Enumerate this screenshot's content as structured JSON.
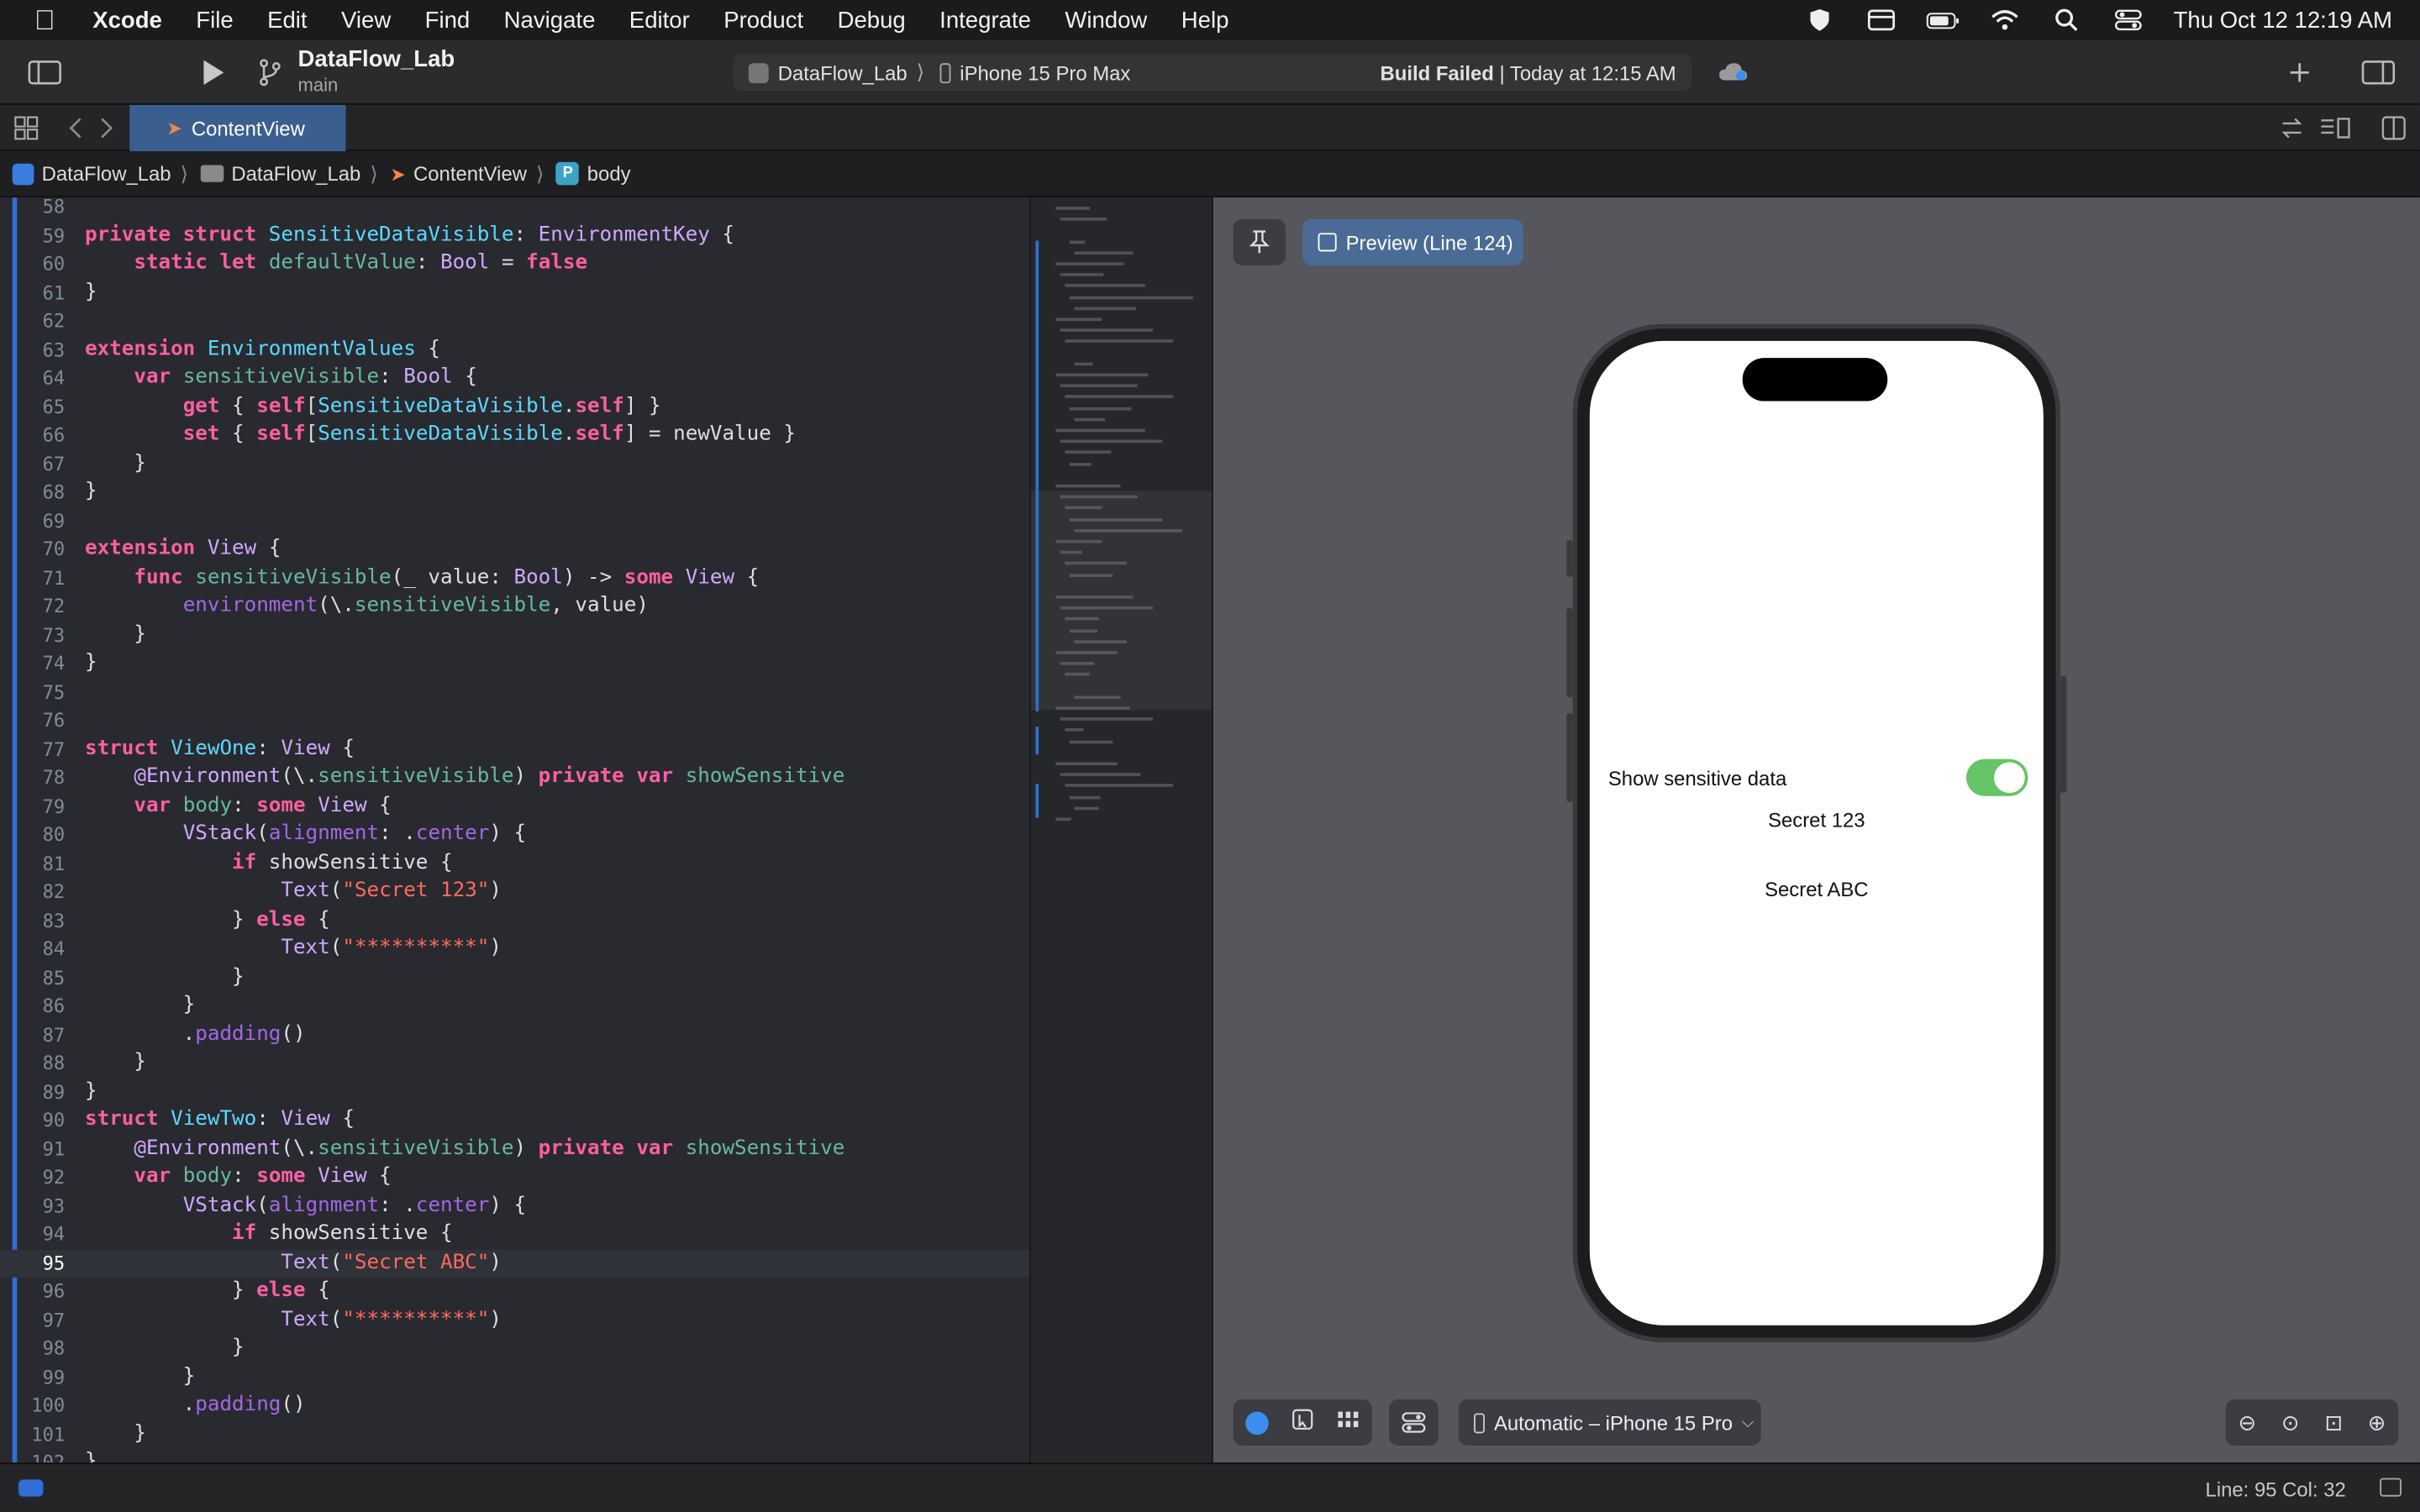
{
  "menubar": {
    "app": "Xcode",
    "items": [
      "File",
      "Edit",
      "View",
      "Find",
      "Navigate",
      "Editor",
      "Product",
      "Debug",
      "Integrate",
      "Window",
      "Help"
    ],
    "clock": "Thu Oct 12  12:19 AM"
  },
  "toolbar": {
    "project_name": "DataFlow_Lab",
    "branch": "main",
    "scheme": "DataFlow_Lab",
    "destination": "iPhone 15 Pro Max",
    "build_status_bold": "Build Failed",
    "build_status_rest": " | Today at 12:15 AM"
  },
  "tab": {
    "label": "ContentView"
  },
  "jumpbar": {
    "project": "DataFlow_Lab",
    "folder": "DataFlow_Lab",
    "file": "ContentView",
    "symbol": "body"
  },
  "editor": {
    "current_line": 95
  },
  "preview": {
    "chip_label": "Preview (Line 124)",
    "toggle_label": "Show sensitive data",
    "toggle_on": true,
    "secret_one": "Secret 123",
    "secret_two": "Secret ABC",
    "device_label": "Automatic – iPhone 15 Pro"
  },
  "statusbar": {
    "position": "Line: 95  Col: 32"
  },
  "colors": {
    "accent": "#2f6fd6",
    "toggle_green": "#65c466",
    "keyword": "#fc5fa3",
    "type": "#5dd8ff",
    "string": "#fc6a5d"
  }
}
